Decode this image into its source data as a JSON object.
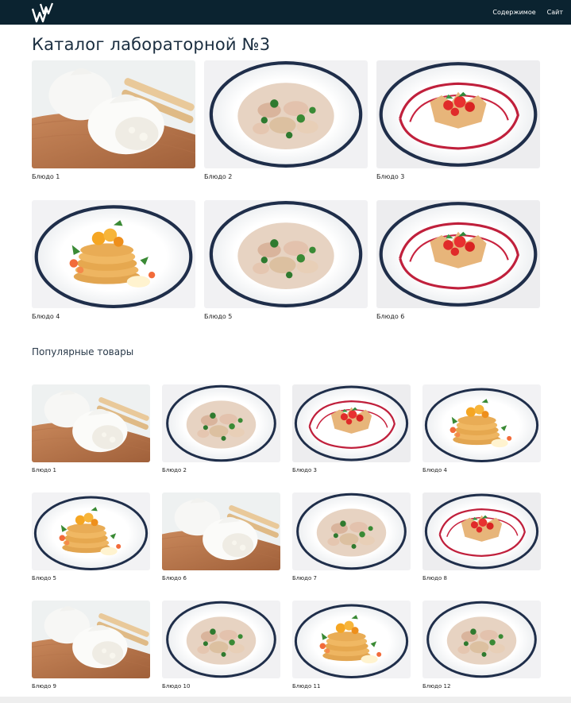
{
  "header": {
    "logo_icon": "ww-logo-icon",
    "nav": [
      {
        "label": "Содержимое"
      },
      {
        "label": "Сайт"
      }
    ],
    "background": "#0b2330"
  },
  "page": {
    "title": "Каталог лабораторной №3"
  },
  "catalog": {
    "items": [
      {
        "label": "Блюдо 1",
        "image": "dumplings-board"
      },
      {
        "label": "Блюдо 2",
        "image": "pasta-plate"
      },
      {
        "label": "Блюдо 3",
        "image": "dessert-basket"
      },
      {
        "label": "Блюдо 4",
        "image": "pancakes-stack"
      },
      {
        "label": "Блюдо 5",
        "image": "pasta-plate"
      },
      {
        "label": "Блюдо 6",
        "image": "dessert-basket"
      }
    ]
  },
  "popular": {
    "title": "Популярные товары",
    "items": [
      {
        "label": "Блюдо 1",
        "image": "dumplings-board"
      },
      {
        "label": "Блюдо 2",
        "image": "pasta-plate"
      },
      {
        "label": "Блюдо 3",
        "image": "dessert-basket"
      },
      {
        "label": "Блюдо 4",
        "image": "pancakes-stack"
      },
      {
        "label": "Блюдо 5",
        "image": "pancakes-stack"
      },
      {
        "label": "Блюдо 6",
        "image": "dumplings-board"
      },
      {
        "label": "Блюдо 7",
        "image": "pasta-plate"
      },
      {
        "label": "Блюдо 8",
        "image": "dessert-basket"
      },
      {
        "label": "Блюдо 9",
        "image": "dumplings-board"
      },
      {
        "label": "Блюдо 10",
        "image": "pasta-plate"
      },
      {
        "label": "Блюдо 11",
        "image": "pancakes-stack"
      },
      {
        "label": "Блюдо 12",
        "image": "pasta-plate"
      }
    ]
  }
}
